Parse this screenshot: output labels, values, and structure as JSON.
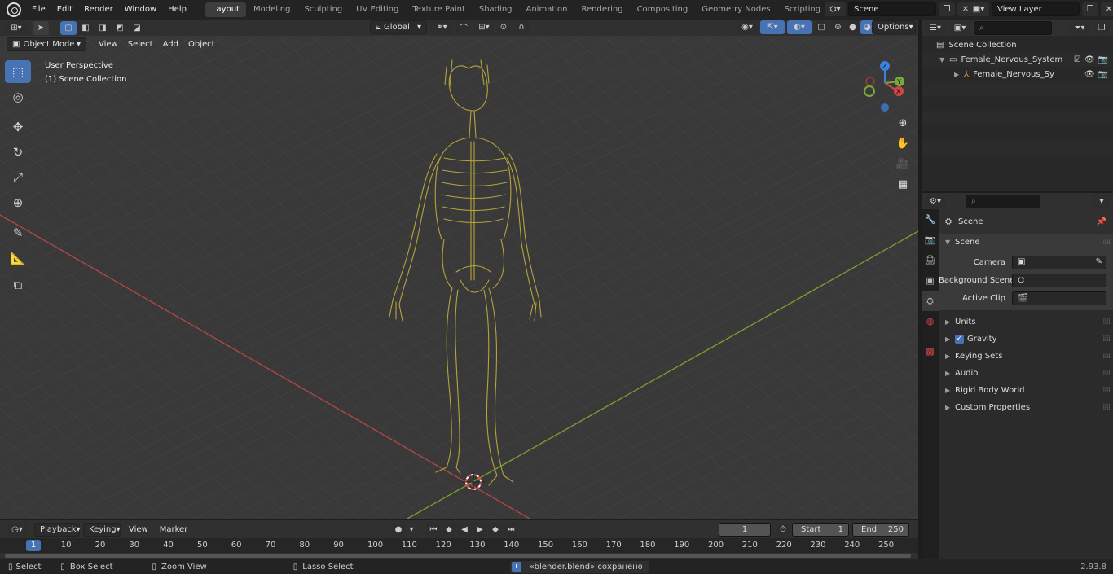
{
  "topbar": {
    "menus": [
      "File",
      "Edit",
      "Render",
      "Window",
      "Help"
    ],
    "workspaces": [
      "Layout",
      "Modeling",
      "Sculpting",
      "UV Editing",
      "Texture Paint",
      "Shading",
      "Animation",
      "Rendering",
      "Compositing",
      "Geometry Nodes",
      "Scripting"
    ],
    "active_workspace": "Layout",
    "scene_name": "Scene",
    "view_layer": "View Layer"
  },
  "viewport_header": {
    "mode": "Object Mode",
    "menus": [
      "View",
      "Select",
      "Add",
      "Object"
    ],
    "transform_orientation": "Global",
    "options_label": "Options"
  },
  "viewport": {
    "perspective_label": "User Perspective",
    "collection_label": "(1) Scene Collection",
    "nerve_color": "#b5a43a",
    "grid_color": "#444444",
    "x_axis_color": "#b04646",
    "y_axis_color": "#7a9e32"
  },
  "outliner": {
    "root": "Scene Collection",
    "items": [
      {
        "label": "Female_Nervous_System",
        "type": "collection"
      },
      {
        "label": "Female_Nervous_System",
        "type": "object"
      }
    ]
  },
  "properties": {
    "context_label": "Scene",
    "section": "Scene",
    "fields": [
      {
        "label": "Camera",
        "icon": "camera-icon"
      },
      {
        "label": "Background Scene",
        "icon": "scene-icon"
      },
      {
        "label": "Active Clip",
        "icon": "clip-icon"
      }
    ],
    "panels": [
      "Units",
      "Gravity",
      "Keying Sets",
      "Audio",
      "Rigid Body World",
      "Custom Properties"
    ],
    "gravity_checked": true
  },
  "timeline": {
    "menus": [
      "Playback",
      "Keying",
      "View",
      "Marker"
    ],
    "current_frame": "1",
    "start_label": "Start",
    "start": "1",
    "end_label": "End",
    "end": "250",
    "ruler": [
      "10",
      "20",
      "30",
      "40",
      "50",
      "60",
      "70",
      "80",
      "90",
      "100",
      "110",
      "120",
      "130",
      "140",
      "150",
      "160",
      "170",
      "180",
      "190",
      "200",
      "210",
      "220",
      "230",
      "240",
      "250"
    ],
    "playhead_label": "1"
  },
  "statusbar": {
    "select": "Select",
    "box_select": "Box Select",
    "zoom_view": "Zoom View",
    "lasso_select": "Lasso Select",
    "message": "«blender.blend» сохранено",
    "version": "2.93.8"
  }
}
